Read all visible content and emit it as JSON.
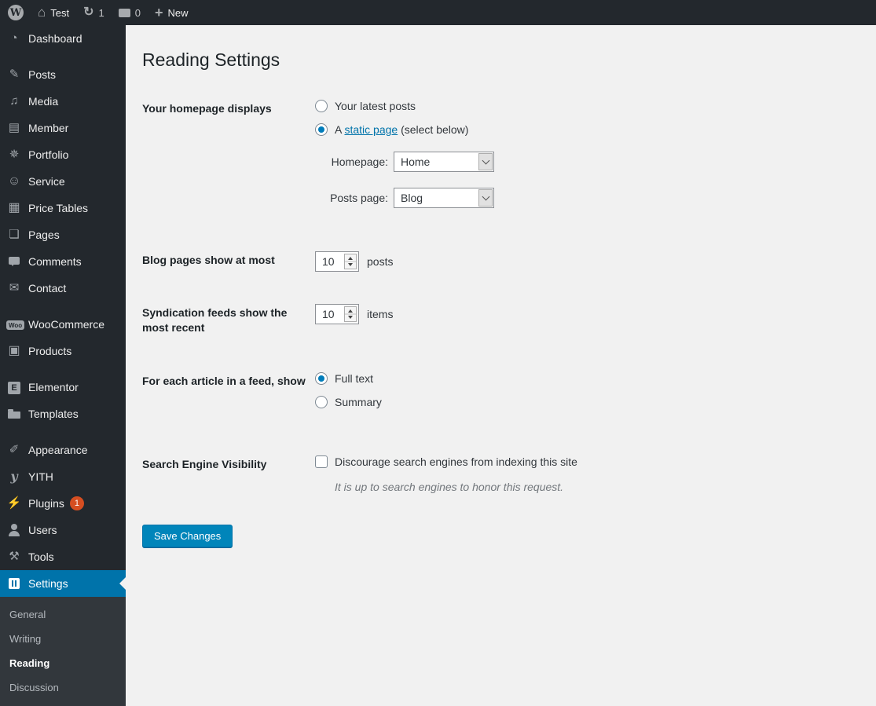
{
  "admin_bar": {
    "wordpress_logo_icon": "wordpress-logo-icon",
    "site_name": "Test",
    "updates_count": "1",
    "comments_count": "0",
    "new_label": "New"
  },
  "sidebar": {
    "items": [
      {
        "label": "Dashboard",
        "icon": "dashboard-gauge-icon"
      },
      {
        "label": "Posts",
        "icon": "pushpin-icon"
      },
      {
        "label": "Media",
        "icon": "media-notes-icon"
      },
      {
        "label": "Member",
        "icon": "member-idcard-icon"
      },
      {
        "label": "Portfolio",
        "icon": "portfolio-award-icon"
      },
      {
        "label": "Service",
        "icon": "service-smiley-icon"
      },
      {
        "label": "Price Tables",
        "icon": "price-tables-grid-icon"
      },
      {
        "label": "Pages",
        "icon": "pages-icon"
      },
      {
        "label": "Comments",
        "icon": "comments-bubble-icon"
      },
      {
        "label": "Contact",
        "icon": "contact-envelope-icon"
      },
      {
        "label": "WooCommerce",
        "icon": "woocommerce-icon"
      },
      {
        "label": "Products",
        "icon": "products-box-icon"
      },
      {
        "label": "Elementor",
        "icon": "elementor-icon"
      },
      {
        "label": "Templates",
        "icon": "templates-folder-icon"
      },
      {
        "label": "Appearance",
        "icon": "appearance-brush-icon"
      },
      {
        "label": "YITH",
        "icon": "yith-icon"
      },
      {
        "label": "Plugins",
        "icon": "plugins-plug-icon",
        "badge": "1"
      },
      {
        "label": "Users",
        "icon": "users-person-icon"
      },
      {
        "label": "Tools",
        "icon": "tools-wrench-icon"
      },
      {
        "label": "Settings",
        "icon": "settings-sliders-icon",
        "active": true
      }
    ],
    "submenu": {
      "items": [
        {
          "label": "General",
          "current": false
        },
        {
          "label": "Writing",
          "current": false
        },
        {
          "label": "Reading",
          "current": true
        },
        {
          "label": "Discussion",
          "current": false
        }
      ]
    }
  },
  "main": {
    "title": "Reading Settings",
    "form": {
      "homepage_displays": {
        "label": "Your homepage displays",
        "latest_posts_option": "Your latest posts",
        "static_prefix": "A ",
        "static_link": "static page",
        "static_suffix": " (select below)",
        "selected_option": "A static page",
        "homepage_label": "Homepage:",
        "homepage_value": "Home",
        "posts_page_label": "Posts page:",
        "posts_page_value": "Blog"
      },
      "blog_pages": {
        "label": "Blog pages show at most",
        "value": "10",
        "unit": "posts"
      },
      "syndication": {
        "label": "Syndication feeds show the most recent",
        "value": "10",
        "unit": "items"
      },
      "feed_article": {
        "label": "For each article in a feed, show",
        "full_text_option": "Full text",
        "summary_option": "Summary",
        "selected_option": "Full text"
      },
      "search_visibility": {
        "label": "Search Engine Visibility",
        "checkbox_label": "Discourage search engines from indexing this site",
        "checked": false,
        "note": "It is up to search engines to honor this request."
      },
      "save_button": "Save Changes"
    }
  },
  "colors": {
    "admin_bar_bg": "#23282d",
    "sidebar_bg": "#23282d",
    "submenu_bg": "#32373c",
    "active_blue": "#0073aa",
    "link_blue": "#0073aa",
    "button_bg": "#0085ba",
    "badge_bg": "#d54e21",
    "content_bg": "#f1f1f1"
  }
}
